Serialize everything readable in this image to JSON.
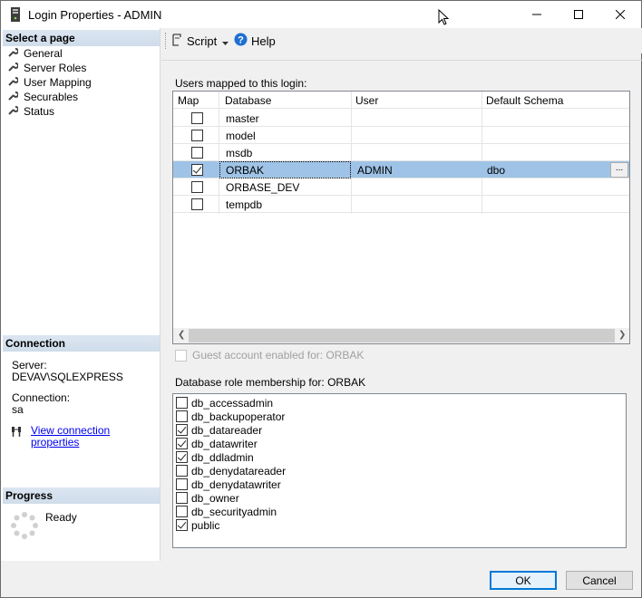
{
  "window": {
    "title": "Login Properties - ADMIN"
  },
  "left": {
    "select_page_header": "Select a page",
    "pages": [
      {
        "label": "General"
      },
      {
        "label": "Server Roles"
      },
      {
        "label": "User Mapping"
      },
      {
        "label": "Securables"
      },
      {
        "label": "Status"
      }
    ],
    "connection_header": "Connection",
    "server_label": "Server:",
    "server_value": "DEVAV\\SQLEXPRESS",
    "connection_label": "Connection:",
    "connection_value": "sa",
    "view_connection_link": "View connection properties",
    "progress_header": "Progress",
    "progress_status": "Ready"
  },
  "toolbar": {
    "script_label": "Script",
    "help_label": "Help"
  },
  "mapping": {
    "label": "Users mapped to this login:",
    "columns": [
      "Map",
      "Database",
      "User",
      "Default Schema"
    ],
    "rows": [
      {
        "checked": false,
        "database": "master",
        "user": "",
        "schema": ""
      },
      {
        "checked": false,
        "database": "model",
        "user": "",
        "schema": ""
      },
      {
        "checked": false,
        "database": "msdb",
        "user": "",
        "schema": ""
      },
      {
        "checked": true,
        "database": "ORBAK",
        "user": "ADMIN",
        "schema": "dbo",
        "selected": true
      },
      {
        "checked": false,
        "database": "ORBASE_DEV",
        "user": "",
        "schema": ""
      },
      {
        "checked": false,
        "database": "tempdb",
        "user": "",
        "schema": ""
      }
    ],
    "ellipsis": "..."
  },
  "guest": {
    "label": "Guest account enabled for: ORBAK",
    "checked": false,
    "enabled": false
  },
  "roles": {
    "label": "Database role membership for: ORBAK",
    "items": [
      {
        "name": "db_accessadmin",
        "checked": false
      },
      {
        "name": "db_backupoperator",
        "checked": false
      },
      {
        "name": "db_datareader",
        "checked": true
      },
      {
        "name": "db_datawriter",
        "checked": true
      },
      {
        "name": "db_ddladmin",
        "checked": true
      },
      {
        "name": "db_denydatareader",
        "checked": false
      },
      {
        "name": "db_denydatawriter",
        "checked": false
      },
      {
        "name": "db_owner",
        "checked": false
      },
      {
        "name": "db_securityadmin",
        "checked": false
      },
      {
        "name": "public",
        "checked": true
      }
    ]
  },
  "buttons": {
    "ok": "OK",
    "cancel": "Cancel"
  },
  "colors": {
    "accent": "#0078d7",
    "selected_row": "#9fc3e7",
    "section_header": "#d4e0ee"
  }
}
